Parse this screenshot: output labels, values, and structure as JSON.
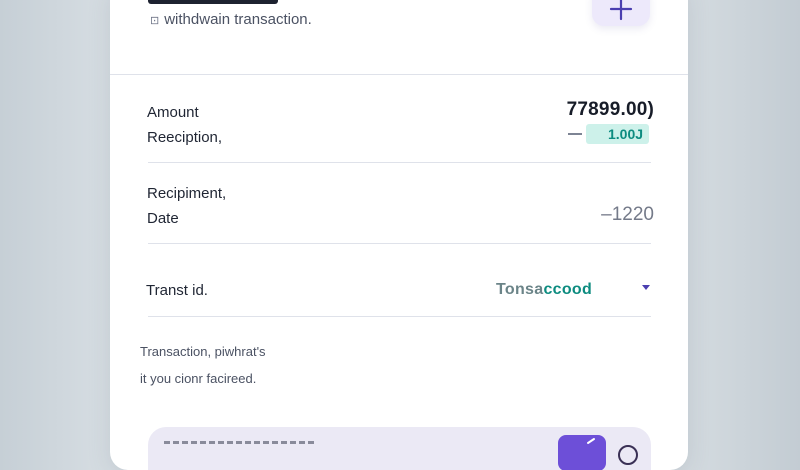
{
  "header": {
    "subtitle": "withdwain transaction.",
    "subtitle_icon_glyph": "⊡"
  },
  "details": {
    "amount_label": "Amount",
    "reception_label": "Reeciption,",
    "amount_value": "77899.00)",
    "fee_value": "1.00J",
    "recipient_label": "Recipiment,",
    "date_label": "Date",
    "date_value": "–1220",
    "txid_label": "Transt id.",
    "txid_value_part1": "Tonsa",
    "txid_value_part2": "ccood"
  },
  "note": {
    "line1": "Transaction, piwhrat's",
    "line2": "it you cionr facireed."
  },
  "colors": {
    "accent": "#6d4fd8",
    "accent_soft": "#ede9fb",
    "teal": "#0d8c80",
    "teal_soft": "#cdf1ea"
  },
  "icons": {
    "add": "plus-icon",
    "dropdown": "caret-down-icon",
    "send": "send-icon"
  }
}
